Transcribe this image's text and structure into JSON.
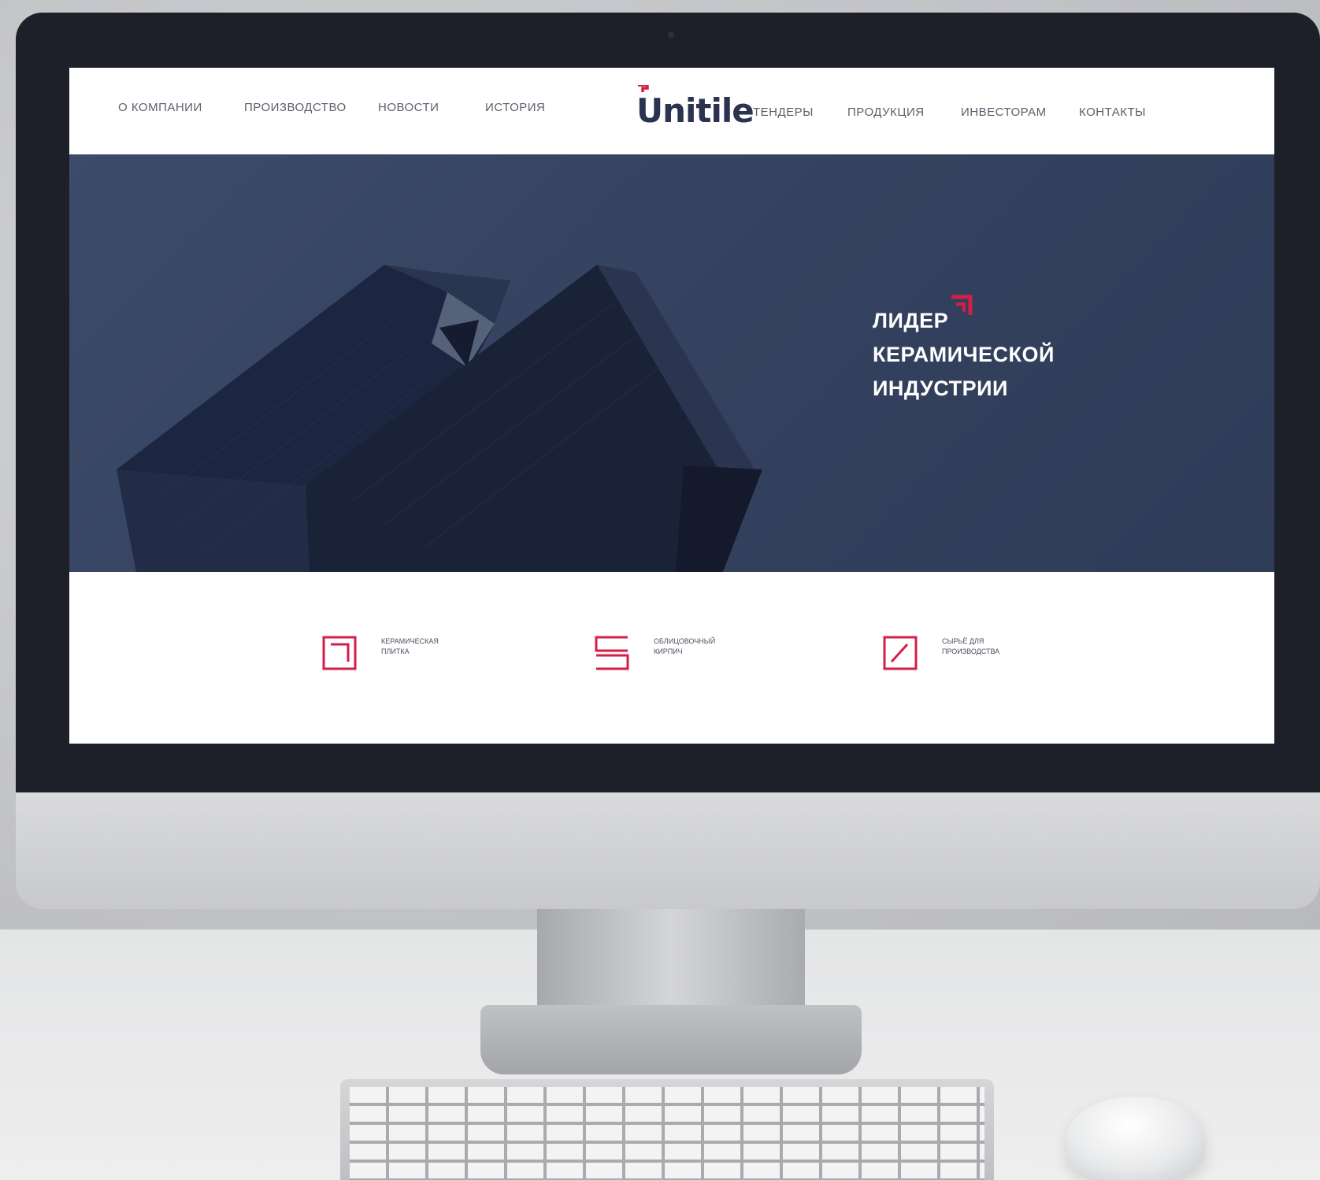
{
  "brand": {
    "logo_text": "Unitile",
    "accent_color": "#d41e46",
    "navy_color": "#2b3350"
  },
  "nav": {
    "left": [
      "О КОМПАНИИ",
      "ПРОИЗВОДСТВО",
      "НОВОСТИ",
      "ИСТОРИЯ"
    ],
    "right": [
      "ТЕНДЕРЫ",
      "ПРОДУКЦИЯ",
      "ИНВЕСТОРАМ",
      "КОНТАКТЫ"
    ]
  },
  "hero": {
    "title_lines": [
      "ЛИДЕР",
      "КЕРАМИЧЕСКОЙ",
      "ИНДУСТРИИ"
    ],
    "icon": "corner-arrow-icon"
  },
  "features": [
    {
      "icon": "tile-square-icon",
      "label": "КЕРАМИЧЕСКАЯ ПЛИТКА"
    },
    {
      "icon": "brick-layers-icon",
      "label": "ОБЛИЦОВОЧНЫЙ КИРПИЧ"
    },
    {
      "icon": "raw-material-slash-icon",
      "label": "СЫРЬЁ ДЛЯ ПРОИЗВОДСТВА"
    }
  ]
}
